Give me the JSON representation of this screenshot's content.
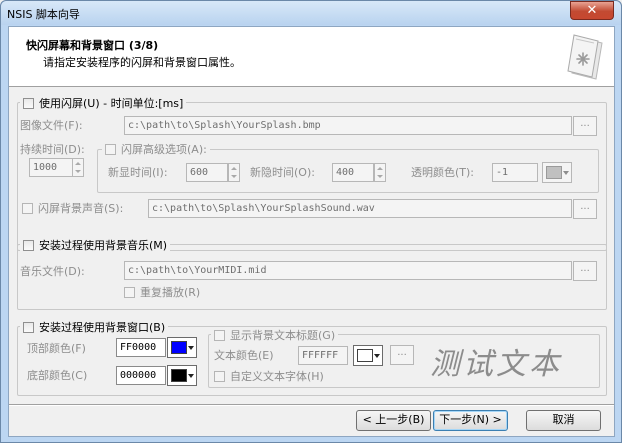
{
  "window": {
    "title": "NSIS 脚本向导",
    "close_glyph": "✕"
  },
  "header": {
    "title": "快闪屏幕和背景窗口 (3/8)",
    "subtitle": "请指定安装程序的闪屏和背景窗口属性。",
    "icon": "wizard-document-icon"
  },
  "splash": {
    "enable_label": "使用闪屏(U) - 时间单位:[ms]",
    "image_file_label": "图像文件(F):",
    "image_file_value": "c:\\path\\to\\Splash\\YourSplash.bmp",
    "browse_label": "...",
    "duration_label": "持续时间(D):",
    "duration_value": "1000",
    "advanced_label": "闪屏高级选项(A):",
    "fade_in_label": "新显时间(I):",
    "fade_in_value": "600",
    "fade_out_label": "新隐时间(O):",
    "fade_out_value": "400",
    "transparent_label": "透明颜色(T):",
    "transparent_value": "-1",
    "transparent_color": "#c0c0c0",
    "sound_label": "闪屏背景声音(S):",
    "sound_value": "c:\\path\\to\\Splash\\YourSplashSound.wav"
  },
  "music": {
    "enable_label": "安装过程使用背景音乐(M)",
    "file_label": "音乐文件(D):",
    "file_value": "c:\\path\\to\\YourMIDI.mid",
    "browse_label": "...",
    "repeat_label": "重复播放(R)"
  },
  "bgwindow": {
    "enable_label": "安装过程使用背景窗口(B)",
    "top_color_label": "顶部颜色(F)",
    "top_color_value": "FF0000",
    "top_color": "#0000ff",
    "bottom_color_label": "底部颜色(C)",
    "bottom_color_value": "000000",
    "bottom_color": "#000000",
    "show_title_label": "显示背景文本标题(G)",
    "text_color_label": "文本颜色(E)",
    "text_color_value": "FFFFFF",
    "text_color": "#ffffff",
    "font_button_label": "...",
    "custom_font_label": "自定义文本字体(H)",
    "preview_text": "测试文本"
  },
  "footer": {
    "back_label": "< 上一步(B)",
    "next_label": "下一步(N) >",
    "cancel_label": "取消"
  }
}
